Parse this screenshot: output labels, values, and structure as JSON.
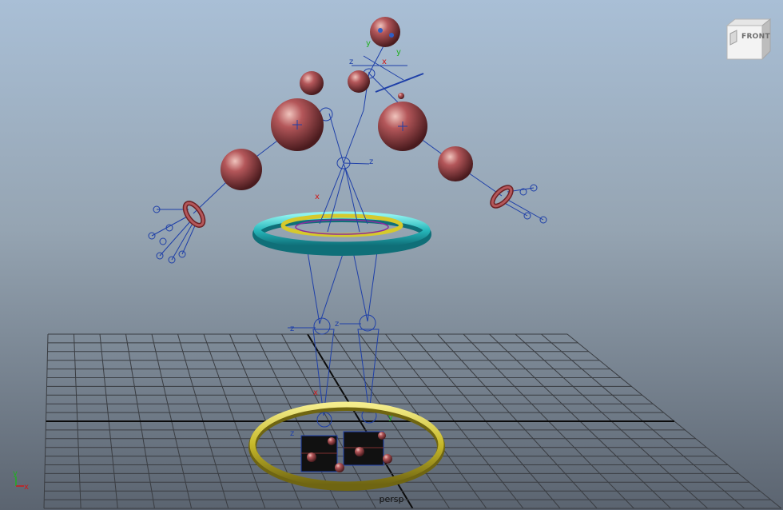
{
  "viewport": {
    "camera_label": "persp",
    "view_cube_face": "FRONT"
  },
  "axis_labels": {
    "x": "x",
    "y": "y",
    "z": "z"
  },
  "colors": {
    "grid": "#3a3d42",
    "grid_axis": "#0b0b0b",
    "joint": "#1e3fa8",
    "sphere": "#a3474b",
    "cyan_ring": "#2fc3c3",
    "yellow_ring": "#cfc227"
  }
}
